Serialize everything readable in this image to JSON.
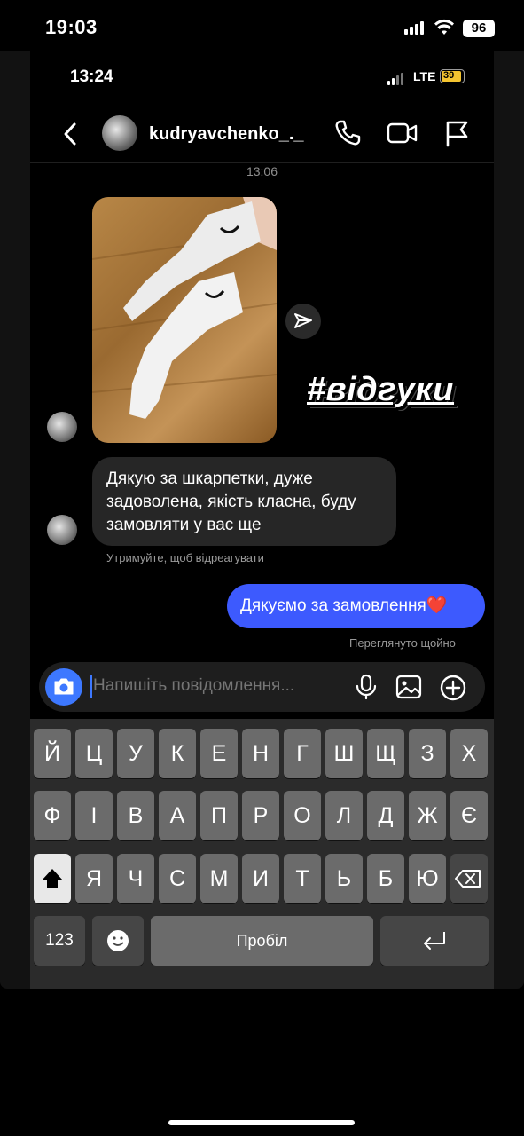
{
  "outer_status": {
    "time": "19:03",
    "battery": "96"
  },
  "inner_status": {
    "time": "13:24",
    "network": "LTE",
    "battery": "39"
  },
  "header": {
    "username": "kudryavchenko_._"
  },
  "chat": {
    "timestamp": "13:06",
    "story_tag": "#відгуки",
    "incoming_message": "Дякую за шкарпетки, дуже задоволена, якість класна, буду замовляти у вас ще",
    "reaction_hint": "Утримуйте, щоб відреагувати",
    "outgoing_message": "Дякуємо за замовлення❤️",
    "seen_status": "Переглянуто щойно"
  },
  "composer": {
    "placeholder": "Напишіть повідомлення..."
  },
  "keyboard": {
    "row1": [
      "Й",
      "Ц",
      "У",
      "К",
      "Е",
      "Н",
      "Г",
      "Ш",
      "Щ",
      "З",
      "Х"
    ],
    "row2": [
      "Ф",
      "І",
      "В",
      "А",
      "П",
      "Р",
      "О",
      "Л",
      "Д",
      "Ж",
      "Є"
    ],
    "row3": [
      "Я",
      "Ч",
      "С",
      "М",
      "И",
      "Т",
      "Ь",
      "Б",
      "Ю"
    ],
    "numbers_key": "123",
    "space_key": "Пробіл"
  },
  "colors": {
    "accent": "#3d5afe",
    "camera": "#3d78ff",
    "background": "#000000",
    "bubble_in": "#262626"
  }
}
